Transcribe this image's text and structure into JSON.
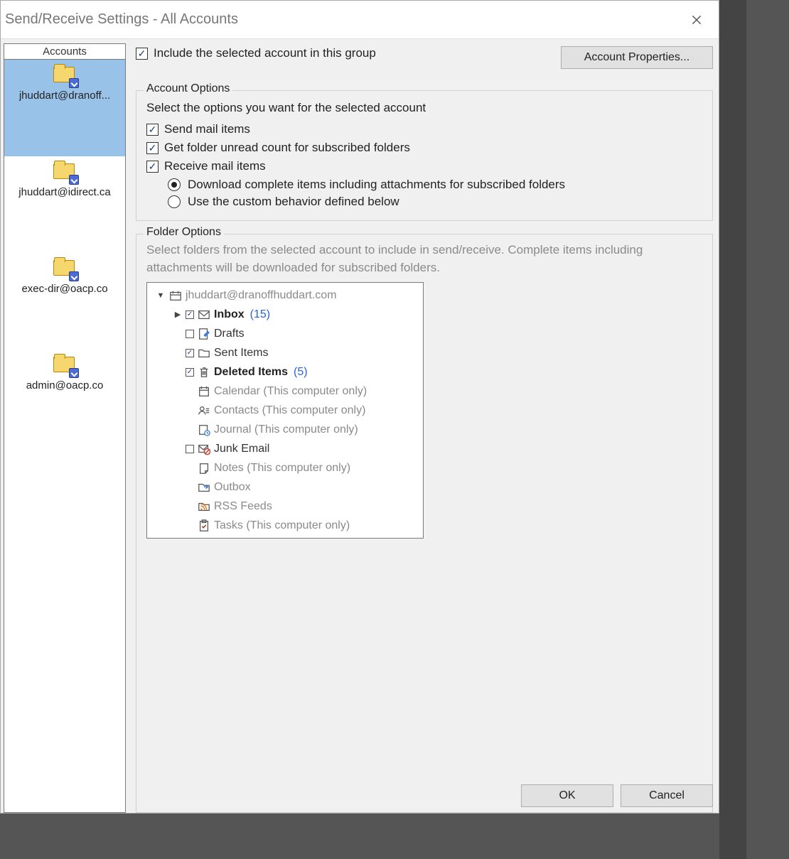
{
  "window": {
    "title": "Send/Receive Settings - All Accounts"
  },
  "sidebar": {
    "header": "Accounts",
    "accounts": [
      {
        "label": "jhuddart@dranoff...",
        "selected": true
      },
      {
        "label": "jhuddart@idirect.ca",
        "selected": false
      },
      {
        "label": "exec-dir@oacp.co",
        "selected": false
      },
      {
        "label": "admin@oacp.co",
        "selected": false
      }
    ]
  },
  "top": {
    "include_label": "Include the selected account in this group",
    "include_checked": true,
    "account_properties_label": "Account Properties..."
  },
  "account_options": {
    "title": "Account Options",
    "description": "Select the options you want for the selected account",
    "send_label": "Send mail items",
    "send_checked": true,
    "unread_label": "Get folder unread count for subscribed folders",
    "unread_checked": true,
    "receive_label": "Receive mail items",
    "receive_checked": true,
    "radio_download_label": "Download complete items including attachments for subscribed folders",
    "radio_download_selected": true,
    "radio_custom_label": "Use the custom behavior defined below",
    "radio_custom_selected": false
  },
  "folder_options": {
    "title": "Folder Options",
    "description": "Select folders from the selected account to include in send/receive. Complete items including attachments will be downloaded for subscribed folders.",
    "root": {
      "label": "jhuddart@dranoffhuddart.com",
      "expanded": true
    },
    "folders": [
      {
        "name": "Inbox",
        "count": "(15)",
        "bold": true,
        "checked": true,
        "expandable": true,
        "icon": "mail"
      },
      {
        "name": "Drafts",
        "checked": false,
        "icon": "draft"
      },
      {
        "name": "Sent Items",
        "checked": true,
        "icon": "folder"
      },
      {
        "name": "Deleted Items",
        "count": "(5)",
        "bold": true,
        "checked": true,
        "icon": "trash"
      },
      {
        "name": "Calendar (This computer only)",
        "disabled": true,
        "icon": "calendar"
      },
      {
        "name": "Contacts (This computer only)",
        "disabled": true,
        "icon": "contacts"
      },
      {
        "name": "Journal (This computer only)",
        "disabled": true,
        "icon": "journal"
      },
      {
        "name": "Junk Email",
        "checked": false,
        "icon": "junk"
      },
      {
        "name": "Notes (This computer only)",
        "disabled": true,
        "icon": "note"
      },
      {
        "name": "Outbox",
        "disabled": true,
        "icon": "outbox"
      },
      {
        "name": "RSS Feeds",
        "disabled": true,
        "icon": "rss"
      },
      {
        "name": "Tasks (This computer only)",
        "disabled": true,
        "icon": "tasks"
      }
    ]
  },
  "buttons": {
    "ok": "OK",
    "cancel": "Cancel"
  }
}
